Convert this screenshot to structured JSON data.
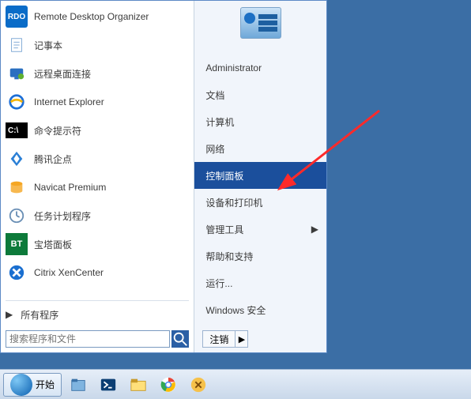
{
  "programs": [
    {
      "label": "Remote Desktop Organizer",
      "icon": "rdo"
    },
    {
      "label": "记事本",
      "icon": "notepad"
    },
    {
      "label": "远程桌面连接",
      "icon": "rdp"
    },
    {
      "label": "Internet Explorer",
      "icon": "ie"
    },
    {
      "label": "命令提示符",
      "icon": "cmd"
    },
    {
      "label": "腾讯企点",
      "icon": "qidian"
    },
    {
      "label": "Navicat Premium",
      "icon": "navicat"
    },
    {
      "label": "任务计划程序",
      "icon": "tasksched"
    },
    {
      "label": "宝塔面板",
      "icon": "bt"
    },
    {
      "label": "Citrix XenCenter",
      "icon": "xen"
    }
  ],
  "all_programs_label": "所有程序",
  "search_placeholder": "搜索程序和文件",
  "right_items": [
    {
      "label": "Administrator",
      "sub": false,
      "selected": false
    },
    {
      "label": "文档",
      "sub": false,
      "selected": false
    },
    {
      "label": "计算机",
      "sub": false,
      "selected": false
    },
    {
      "label": "网络",
      "sub": false,
      "selected": false
    },
    {
      "label": "控制面板",
      "sub": false,
      "selected": true
    },
    {
      "label": "设备和打印机",
      "sub": false,
      "selected": false
    },
    {
      "label": "管理工具",
      "sub": true,
      "selected": false
    },
    {
      "label": "帮助和支持",
      "sub": false,
      "selected": false
    },
    {
      "label": "运行...",
      "sub": false,
      "selected": false
    },
    {
      "label": "Windows 安全",
      "sub": false,
      "selected": false
    }
  ],
  "logout_label": "注销",
  "start_button_label": "开始",
  "annotation_arrow_color": "#ff2a2a"
}
